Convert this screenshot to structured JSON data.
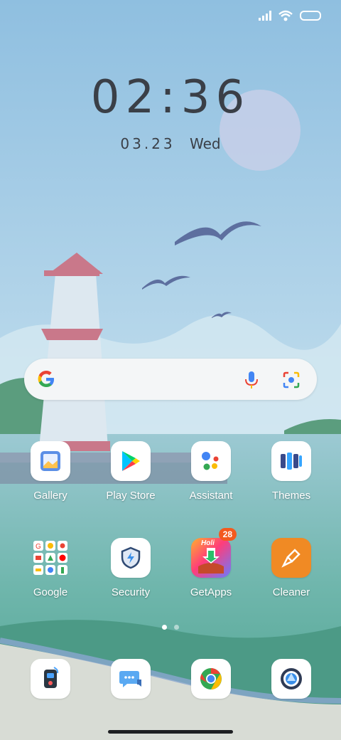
{
  "status": {
    "signal_icon": "signal-icon",
    "wifi_icon": "wifi-icon",
    "battery_icon": "battery-icon"
  },
  "clock": {
    "time": "02:36",
    "date": "03.23",
    "weekday": "Wed"
  },
  "search": {
    "logo": "google-logo",
    "mic": "mic-icon",
    "lens": "lens-icon"
  },
  "apps": [
    {
      "label": "Gallery"
    },
    {
      "label": "Play Store"
    },
    {
      "label": "Assistant"
    },
    {
      "label": "Themes"
    },
    {
      "label": "Google"
    },
    {
      "label": "Security"
    },
    {
      "label": "GetApps",
      "badge": "28",
      "badge_text": "Holi"
    },
    {
      "label": "Cleaner"
    }
  ],
  "pages": {
    "count": 2,
    "active": 1
  },
  "dock": [
    "phone-icon",
    "messaging-icon",
    "chrome-icon",
    "camera-icon"
  ],
  "colors": {
    "accent_orange": "#f35a1e",
    "sky": "#a9cfe6",
    "sea": "#7fbfba"
  }
}
